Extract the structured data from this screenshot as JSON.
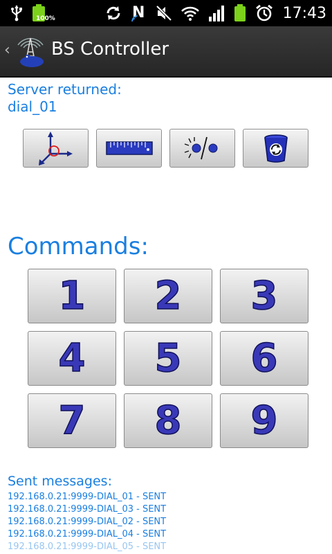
{
  "status_bar": {
    "battery_percent": "100%",
    "time": "17:43",
    "icons": [
      "usb-icon",
      "battery-full-icon",
      "sync-icon",
      "nfc-icon",
      "mute-icon",
      "wifi-icon",
      "signal-icon",
      "battery-icon",
      "alarm-icon"
    ]
  },
  "action_bar": {
    "title": "BS Controller"
  },
  "server": {
    "label": "Server returned:",
    "value": "dial_01"
  },
  "toolbar": {
    "buttons": [
      "axes-icon",
      "ruler-icon",
      "brightness-icon",
      "recycle-bin-icon"
    ]
  },
  "commands": {
    "heading": "Commands:",
    "buttons": [
      "1",
      "2",
      "3",
      "4",
      "5",
      "6",
      "7",
      "8",
      "9"
    ]
  },
  "sent": {
    "label": "Sent messages:",
    "messages": [
      "192.168.0.21:9999-DIAL_01 - SENT",
      "192.168.0.21:9999-DIAL_03 - SENT",
      "192.168.0.21:9999-DIAL_02 - SENT",
      "192.168.0.21:9999-DIAL_04 - SENT",
      "192.168.0.21:9999-DIAL_05 - SENT"
    ]
  },
  "colors": {
    "accent_text": "#1a7fe0",
    "number_fill": "#3939b8"
  }
}
